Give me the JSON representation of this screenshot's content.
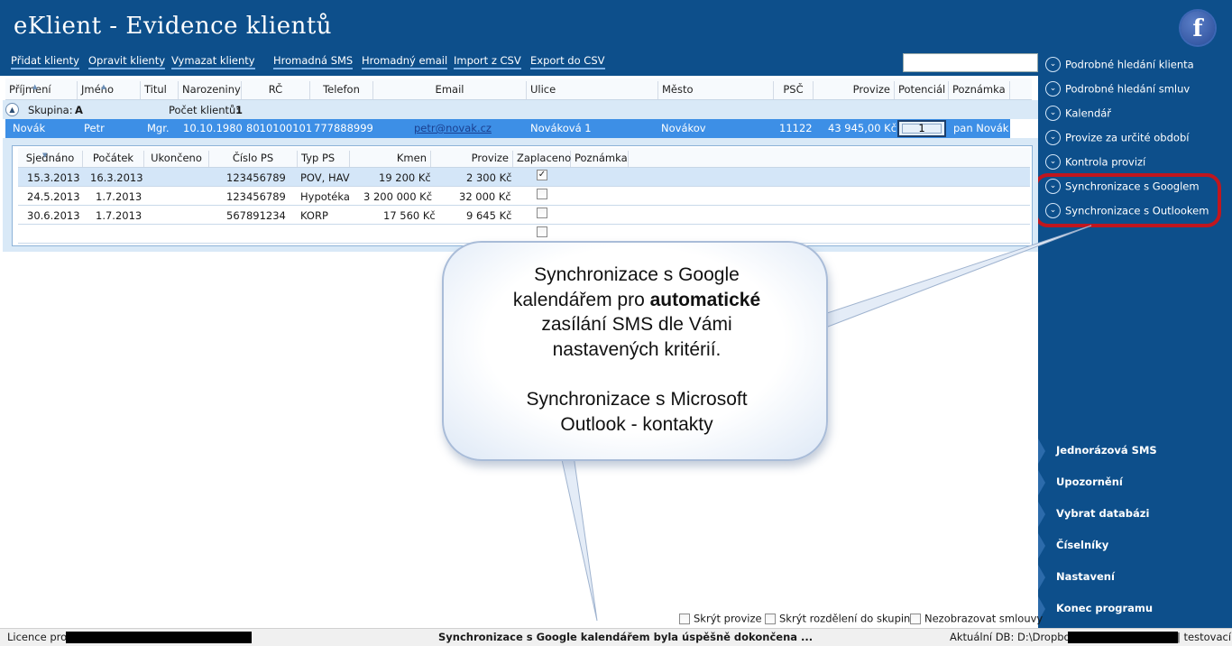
{
  "app": {
    "title": "eKlient - Evidence klientů",
    "facebook_letter": "f"
  },
  "toolbar": {
    "add": "Přidat klienty",
    "edit": "Opravit klienty",
    "delete": "Vymazat klienty",
    "mass_sms": "Hromadná SMS",
    "mass_email": "Hromadný email",
    "import_csv": "Import z CSV",
    "export_csv": "Export do CSV",
    "search_value": ""
  },
  "grid": {
    "columns": {
      "prijmeni": "Příjmení",
      "jmeno": "Jméno",
      "titul": "Titul",
      "narozeniny": "Narozeniny",
      "rc": "RČ",
      "telefon": "Telefon",
      "email": "Email",
      "ulice": "Ulice",
      "mesto": "Město",
      "psc": "PSČ",
      "provize": "Provize",
      "potencial": "Potenciál",
      "poznamka": "Poznámka"
    },
    "group": {
      "label": "Skupina:",
      "value": "A",
      "count_label": "Počet klientů:",
      "count_value": "1"
    },
    "client": {
      "prijmeni": "Novák",
      "jmeno": "Petr",
      "titul": "Mgr.",
      "narozeniny": "10.10.1980",
      "rc": "8010100101",
      "telefon": "777888999",
      "email": "petr@novak.cz",
      "ulice": "Nováková 1",
      "mesto": "Novákov",
      "psc": "11122",
      "provize": "43 945,00 Kč",
      "potencial": "1",
      "poznamka": "pan Novák"
    }
  },
  "contracts": {
    "columns": {
      "sjednano": "Sjednáno",
      "pocatek": "Počátek",
      "ukonceno": "Ukončeno",
      "cislo_ps": "Číslo PS",
      "typ_ps": "Typ PS",
      "kmen": "Kmen",
      "provize": "Provize",
      "zaplaceno": "Zaplaceno",
      "poznamka": "Poznámka"
    },
    "rows": [
      {
        "sjednano": "15.3.2013",
        "pocatek": "16.3.2013",
        "ukonceno": "",
        "cislo_ps": "123456789",
        "typ_ps": "POV, HAV",
        "kmen": "19 200 Kč",
        "provize": "2 300 Kč",
        "zaplaceno": true
      },
      {
        "sjednano": "24.5.2013",
        "pocatek": "1.7.2013",
        "ukonceno": "",
        "cislo_ps": "123456789",
        "typ_ps": "Hypotéka",
        "kmen": "3 200 000 Kč",
        "provize": "32 000 Kč",
        "zaplaceno": false
      },
      {
        "sjednano": "30.6.2013",
        "pocatek": "1.7.2013",
        "ukonceno": "",
        "cislo_ps": "567891234",
        "typ_ps": "KORP",
        "kmen": "17 560 Kč",
        "provize": "9 645 Kč",
        "zaplaceno": false
      }
    ],
    "checkmark": "✓"
  },
  "sidebar": {
    "nav": [
      "Podrobné hledání klienta",
      "Podrobné hledání smluv",
      "Kalendář",
      "Provize za určité období",
      "Kontrola provizí",
      "Synchronizace s Googlem",
      "Synchronizace s Outlookem"
    ],
    "buttons": [
      "Jednorázová SMS",
      "Upozornění",
      "Vybrat databázi",
      "Číselníky",
      "Nastavení",
      "Konec programu"
    ]
  },
  "callout": {
    "line1": "Synchronizace s Google",
    "line2a": "kalendářem pro ",
    "line2b": "automatické",
    "line3": "zasílání SMS dle Vámi",
    "line4": "nastavených kritérií.",
    "line5": "Synchronizace s Microsoft",
    "line6": "Outlook - kontakty"
  },
  "options": {
    "hide_provize": "Skrýt provize",
    "hide_groups": "Skrýt rozdělení do skupin",
    "hide_contracts": "Nezobrazovat smlouvy"
  },
  "status": {
    "license_label": "Licence pro:",
    "message": "Synchronizace s Google kalendářem byla úspěšně dokončena ...",
    "db_label": "Aktuální DB: D:\\Dropbox",
    "db_suffix": "| testovací"
  },
  "colors": {
    "primary": "#0d4f8b",
    "selected_row": "#3d8fe6",
    "highlight_ring": "#c0161e"
  }
}
